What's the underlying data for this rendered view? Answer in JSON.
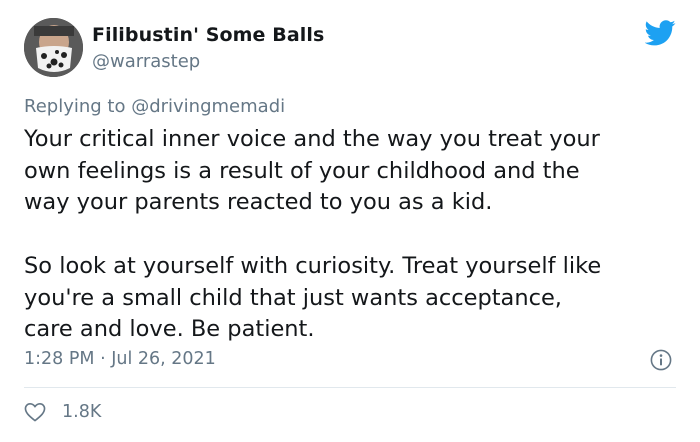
{
  "tweet": {
    "author": {
      "display_name": "Filibustin' Some Balls",
      "handle": "@warrastep",
      "avatar_icon": "avatar-icon"
    },
    "replying_prefix": "Replying to ",
    "replying_to": "@drivingmemadi",
    "body": "Your critical inner voice and the way you treat your\nown feelings is a result of your childhood and the\nway your parents reacted to you as a kid.\n\nSo look at yourself with curiosity. Treat yourself like\nyou're a small child that just wants acceptance,\ncare and love. Be patient.",
    "timestamp": "1:28 PM · Jul 26, 2021",
    "like_count": "1.8K",
    "brand_icon": "twitter-bird-icon",
    "info_icon": "info-icon",
    "like_icon": "heart-icon"
  },
  "colors": {
    "brand": "#1da1f2",
    "text": "#14171a",
    "secondary": "#657786",
    "divider": "#e1e8ed"
  }
}
